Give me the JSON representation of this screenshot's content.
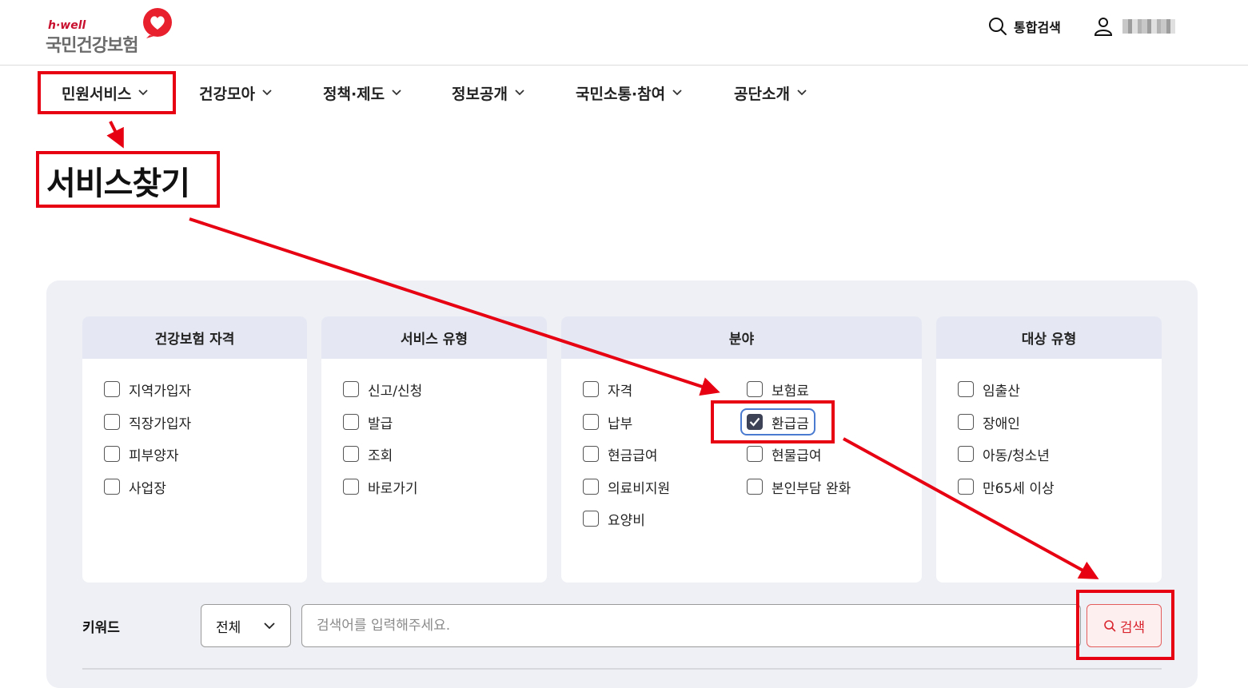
{
  "header": {
    "logo_sub": "h·well",
    "logo_main": "국민건강보험",
    "search_label": "통합검색",
    "colors": {
      "brand_red": "#e8202e",
      "logo_gray": "#6b6b6b"
    }
  },
  "gnb": {
    "items": [
      {
        "label": "민원서비스",
        "icon": "chevron-down-icon"
      },
      {
        "label": "건강모아",
        "icon": "chevron-down-icon"
      },
      {
        "label": "정책·제도",
        "icon": "chevron-down-icon"
      },
      {
        "label": "정보공개",
        "icon": "chevron-down-icon"
      },
      {
        "label": "국민소통·참여",
        "icon": "chevron-down-icon"
      },
      {
        "label": "공단소개",
        "icon": "chevron-down-icon"
      }
    ]
  },
  "page": {
    "title": "서비스찾기"
  },
  "filters": {
    "categories": [
      {
        "title": "건강보험 자격",
        "options": [
          {
            "label": "지역가입자",
            "checked": false
          },
          {
            "label": "직장가입자",
            "checked": false
          },
          {
            "label": "피부양자",
            "checked": false
          },
          {
            "label": "사업장",
            "checked": false
          }
        ]
      },
      {
        "title": "서비스 유형",
        "options": [
          {
            "label": "신고/신청",
            "checked": false
          },
          {
            "label": "발급",
            "checked": false
          },
          {
            "label": "조회",
            "checked": false
          },
          {
            "label": "바로가기",
            "checked": false
          }
        ]
      },
      {
        "title": "분야",
        "options": [
          {
            "label": "자격",
            "checked": false
          },
          {
            "label": "보험료",
            "checked": false
          },
          {
            "label": "납부",
            "checked": false
          },
          {
            "label": "환급금",
            "checked": true
          },
          {
            "label": "현금급여",
            "checked": false
          },
          {
            "label": "현물급여",
            "checked": false
          },
          {
            "label": "의료비지원",
            "checked": false
          },
          {
            "label": "본인부담 완화",
            "checked": false
          },
          {
            "label": "요양비",
            "checked": false
          }
        ]
      },
      {
        "title": "대상 유형",
        "options": [
          {
            "label": "임출산",
            "checked": false
          },
          {
            "label": "장애인",
            "checked": false
          },
          {
            "label": "아동/청소년",
            "checked": false
          },
          {
            "label": "만65세 이상",
            "checked": false
          }
        ]
      }
    ]
  },
  "keyword": {
    "label": "키워드",
    "select_value": "전체",
    "input_value": "",
    "placeholder": "검색어를 입력해주세요.",
    "button_label": "검색"
  },
  "annotation": {
    "color": "#e60012"
  }
}
